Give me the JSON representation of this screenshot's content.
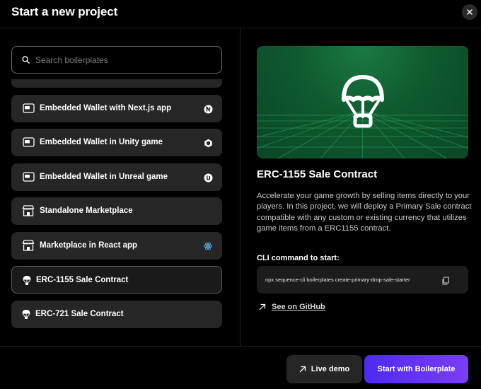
{
  "header": {
    "title": "Start a new project"
  },
  "search": {
    "placeholder": "Search boilerplates"
  },
  "list": {
    "items": [
      {
        "label": "",
        "icon": "partial-item"
      },
      {
        "label": "Embedded Wallet with Next.js app",
        "icon": "wallet-icon",
        "badge": "nextjs-icon"
      },
      {
        "label": "Embedded Wallet in Unity game",
        "icon": "wallet-icon",
        "badge": "unity-icon"
      },
      {
        "label": "Embedded Wallet in Unreal game",
        "icon": "wallet-icon",
        "badge": "unreal-icon"
      },
      {
        "label": "Standalone Marketplace",
        "icon": "storefront-icon"
      },
      {
        "label": "Marketplace in React app",
        "icon": "storefront-icon",
        "badge": "react-icon"
      },
      {
        "label": "ERC-1155 Sale Contract",
        "icon": "parachute-icon",
        "selected": true
      },
      {
        "label": "ERC-721 Sale Contract",
        "icon": "parachute-icon"
      }
    ]
  },
  "detail": {
    "hero_icon": "parachute-icon",
    "title": "ERC-1155 Sale Contract",
    "description": "Accelerate your game growth by selling items directly to your players. In this project, we will deploy a Primary Sale contract compatible with any custom or existing currency that utilizes game items from a ERC1155 contract.",
    "cli_label": "CLI command to start:",
    "cli_command": "npx sequence-cli boilerplates create-primary-drop-sale-starter",
    "github_link": "See on GitHub"
  },
  "footer": {
    "live_demo": "Live demo",
    "start": "Start with Boilerplate"
  },
  "colors": {
    "accent_start": "#4c2bf0",
    "accent_end": "#7b3cf7",
    "hero_green": "#0f5a30"
  }
}
